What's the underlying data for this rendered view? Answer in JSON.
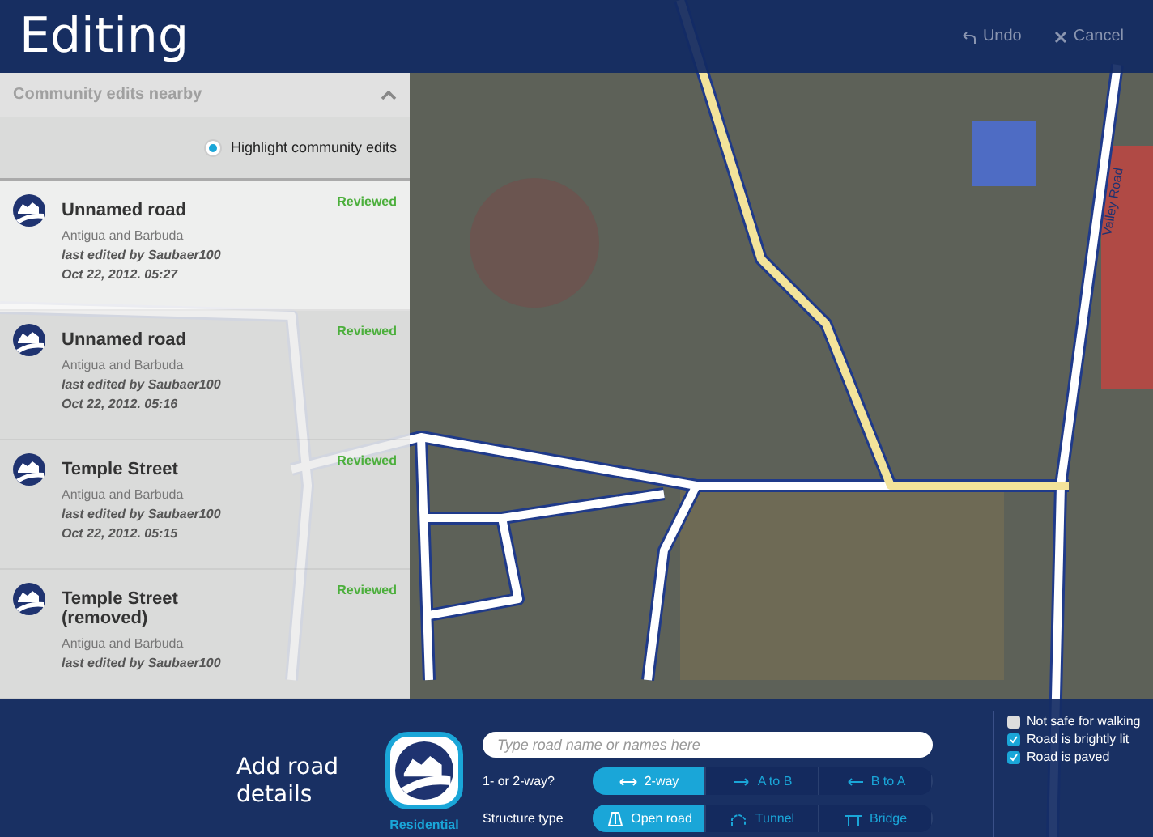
{
  "header": {
    "title": "Editing",
    "actions": [
      {
        "label": "Undo",
        "kind": "undo"
      },
      {
        "label": "Cancel",
        "kind": "cancel"
      }
    ]
  },
  "sidebar": {
    "section": {
      "title": "Community edits nearby",
      "expanded": true
    },
    "highlight_toggle": {
      "label": "Highlight community edits",
      "on": true
    },
    "edits": [
      {
        "name": "Unnamed road",
        "region": "Antigua and Barbuda",
        "editor": "last edited by Saubaer100",
        "date": "Oct 22, 2012. 05:27",
        "status": "Reviewed",
        "selected": true
      },
      {
        "name": "Unnamed road",
        "region": "Antigua and Barbuda",
        "editor": "last edited by Saubaer100",
        "date": "Oct 22, 2012. 05:16",
        "status": "Reviewed",
        "selected": false
      },
      {
        "name": "Temple Street",
        "region": "Antigua and Barbuda",
        "editor": "last edited by Saubaer100",
        "date": "Oct 22, 2012. 05:15",
        "status": "Reviewed",
        "selected": false
      },
      {
        "name": "Temple Street (removed)",
        "region": "Antigua and Barbuda",
        "editor": "last edited by Saubaer100",
        "status": "Reviewed",
        "selected": false
      }
    ]
  },
  "map": {
    "road_label": "Valley Road"
  },
  "details": {
    "title": "Add road details",
    "road_type": {
      "label": "Residential"
    },
    "name_field": {
      "placeholder": "Type road name or names here"
    },
    "direction": {
      "label": "1- or 2-way?",
      "options": [
        {
          "label": "2-way",
          "kind": "both",
          "selected": true
        },
        {
          "label": "A to B",
          "kind": "forward",
          "selected": false
        },
        {
          "label": "B to A",
          "kind": "back",
          "selected": false
        }
      ]
    },
    "structure": {
      "label": "Structure type",
      "options": [
        {
          "label": "Open road",
          "kind": "open",
          "selected": true
        },
        {
          "label": "Tunnel",
          "kind": "tunnel",
          "selected": false
        },
        {
          "label": "Bridge",
          "kind": "bridge",
          "selected": false
        }
      ]
    },
    "checks": [
      {
        "label": "Not safe for walking",
        "checked": false
      },
      {
        "label": "Road is brightly lit",
        "checked": true
      },
      {
        "label": "Road is paved",
        "checked": true
      }
    ]
  }
}
